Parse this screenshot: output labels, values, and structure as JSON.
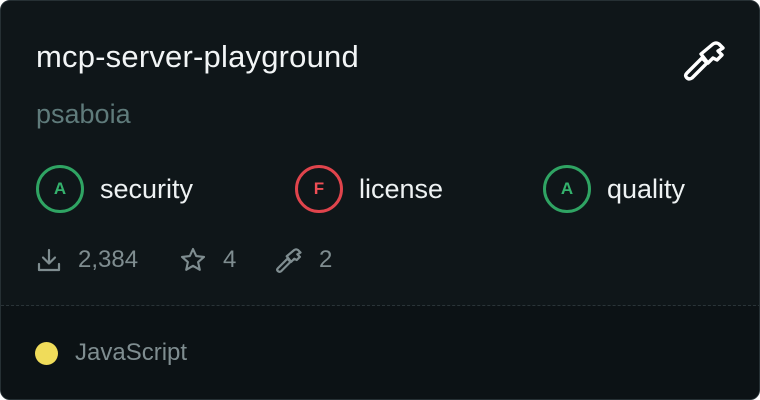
{
  "card": {
    "title": "mcp-server-playground",
    "owner": "psaboia",
    "grades": {
      "security": {
        "letter": "A",
        "label": "security"
      },
      "license": {
        "letter": "F",
        "label": "license"
      },
      "quality": {
        "letter": "A",
        "label": "quality"
      }
    },
    "stats": {
      "downloads": "2,384",
      "stars": "4",
      "tools": "2"
    },
    "language": {
      "name": "JavaScript",
      "color": "#f0dc5a"
    }
  },
  "colors": {
    "background": "#0f1619",
    "pass": "#34b26d",
    "fail": "#ef4e55",
    "muted": "#7f8d90"
  },
  "icons": {
    "header": "hammer-icon",
    "downloads": "download-icon",
    "stars": "star-icon",
    "tools": "hammer-icon"
  }
}
